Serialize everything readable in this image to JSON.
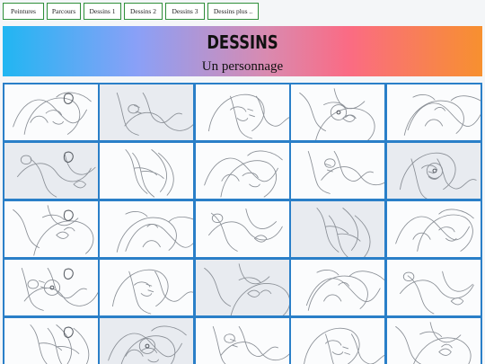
{
  "nav": {
    "items": [
      "Peintures",
      "Parcours",
      "Dessins 1",
      "Dessins 2",
      "Dessins 3",
      "Dessins plus .."
    ]
  },
  "banner": {
    "title": "DESSINS",
    "subtitle": "Un personnage"
  },
  "colors": {
    "nav_border": "#2f8f3a",
    "thumb_border": "#2a7fc8",
    "gradient": [
      "#21b6f2",
      "#8aa0f7",
      "#d98ab0",
      "#fa6b84",
      "#f7902f"
    ]
  },
  "gallery": {
    "columns": 5,
    "visible_rows": 5
  }
}
